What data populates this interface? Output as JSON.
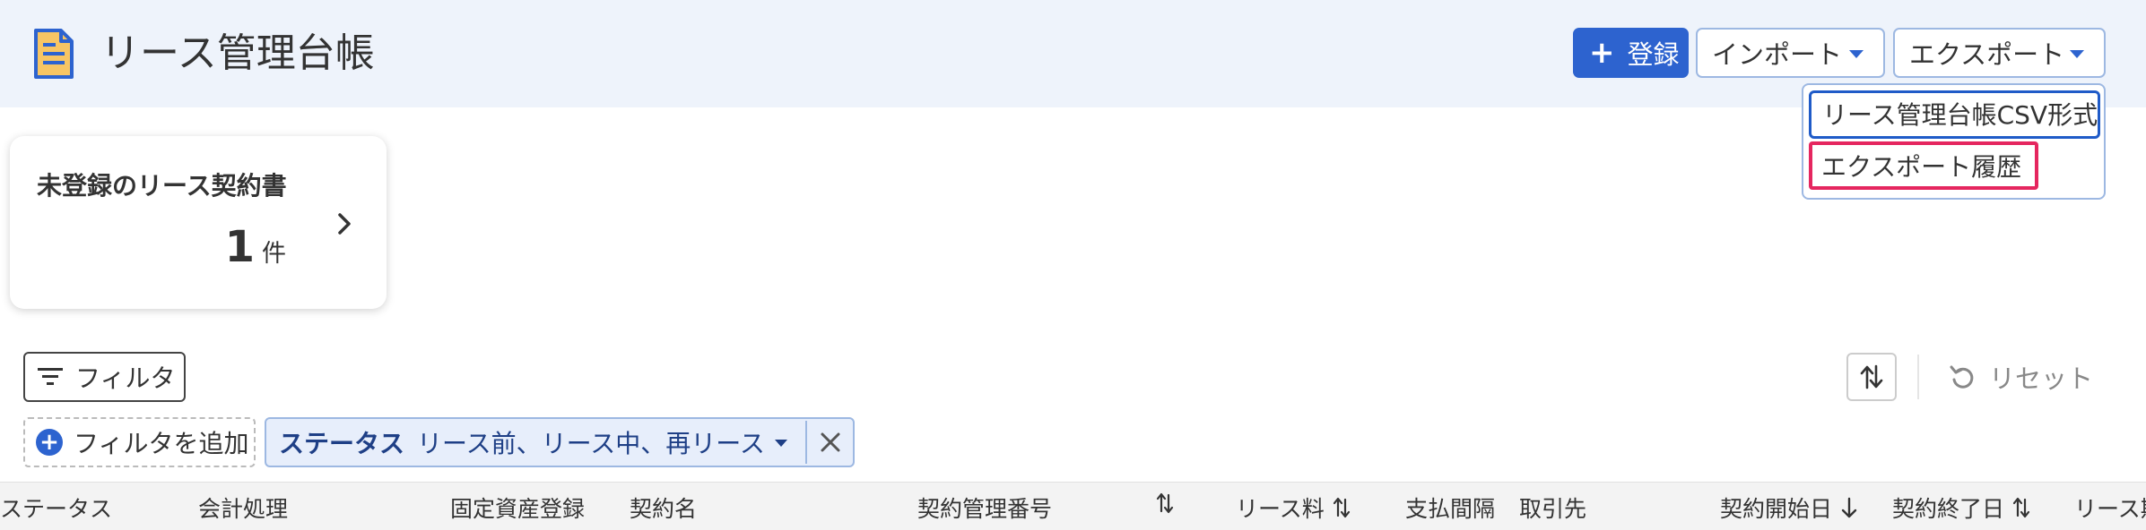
{
  "header": {
    "title": "リース管理台帳",
    "register_label": "登録",
    "import_label": "インポート",
    "export_label": "エクスポート"
  },
  "export_menu": {
    "items": [
      "リース管理台帳CSV形式",
      "エクスポート履歴"
    ]
  },
  "summary_card": {
    "title": "未登録のリース契約書",
    "count": "1",
    "unit": "件"
  },
  "toolbar": {
    "filter_label": "フィルタ",
    "reset_label": "リセット",
    "add_filter_label": "フィルタを追加"
  },
  "active_filter": {
    "label": "ステータス",
    "value": "リース前、リース中、再リース"
  },
  "table": {
    "columns": [
      "ステータス",
      "会計処理",
      "固定資産登録",
      "契約名",
      "契約管理番号",
      "",
      "リース料",
      "支払間隔",
      "取引先",
      "契約開始日",
      "契約終了日",
      "リース期"
    ]
  },
  "colors": {
    "accent": "#2d63cf",
    "header_bg": "#eef3fb",
    "highlight": "#e5265f"
  }
}
